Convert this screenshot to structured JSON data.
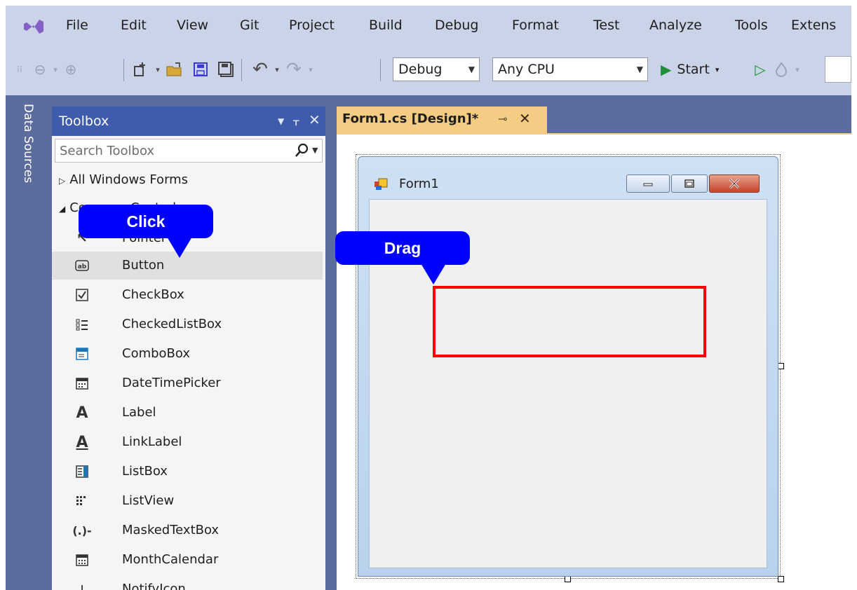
{
  "menubar": {
    "items": [
      "File",
      "Edit",
      "View",
      "Git",
      "Project",
      "Build",
      "Debug",
      "Format",
      "Test",
      "Analyze",
      "Tools",
      "Extens"
    ]
  },
  "toolbar": {
    "configuration": "Debug",
    "platform": "Any CPU",
    "start_label": "Start",
    "start_icon": "play-icon",
    "colors": {
      "start_green": "#1d8e3a"
    }
  },
  "data_sources": {
    "label": "Data Sources"
  },
  "toolbox": {
    "title": "Toolbox",
    "search_placeholder": "Search Toolbox",
    "groups": [
      {
        "label": "All Windows Forms",
        "expanded": false
      },
      {
        "label": "Common Controls",
        "expanded": true
      }
    ],
    "items": [
      {
        "label": "Pointer",
        "icon": "pointer-icon"
      },
      {
        "label": "Button",
        "icon": "button-icon",
        "selected": true
      },
      {
        "label": "CheckBox",
        "icon": "checkbox-icon"
      },
      {
        "label": "CheckedListBox",
        "icon": "checkedlistbox-icon"
      },
      {
        "label": "ComboBox",
        "icon": "combobox-icon"
      },
      {
        "label": "DateTimePicker",
        "icon": "datetimepicker-icon"
      },
      {
        "label": "Label",
        "icon": "label-icon"
      },
      {
        "label": "LinkLabel",
        "icon": "linklabel-icon"
      },
      {
        "label": "ListBox",
        "icon": "listbox-icon"
      },
      {
        "label": "ListView",
        "icon": "listview-icon"
      },
      {
        "label": "MaskedTextBox",
        "icon": "maskedtextbox-icon"
      },
      {
        "label": "MonthCalendar",
        "icon": "monthcalendar-icon"
      },
      {
        "label": "NotifyIcon",
        "icon": "notifyicon-icon"
      }
    ]
  },
  "editor": {
    "tab_label": "Form1.cs [Design]*",
    "form_title": "Form1"
  },
  "annotations": {
    "click_label": "Click",
    "drag_label": "Drag",
    "colors": {
      "callout": "#0000ff",
      "drag_box": "#ff0000",
      "active_tab": "#f5cc84"
    }
  }
}
